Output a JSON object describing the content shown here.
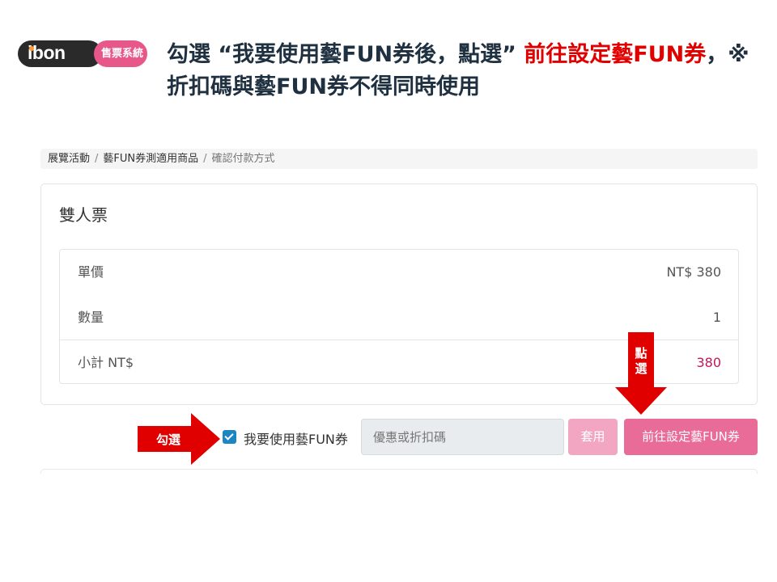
{
  "logo": {
    "brand": "ibon",
    "system": "售票系統"
  },
  "headline": {
    "part1": "勾選 “我要使用藝FUN券後，點選” ",
    "part2_red": "前往設定藝FUN券",
    "part3": "，※折扣碼與藝FUN券不得同時使用"
  },
  "breadcrumb": {
    "items": [
      "展覽活動",
      "藝FUN券測適用商品"
    ],
    "separator": "/",
    "current": "確認付款方式"
  },
  "ticket": {
    "title": "雙人票",
    "unit_price_label": "單價",
    "unit_price_value": "NT$  380",
    "quantity_label": "數量",
    "quantity_value": "1",
    "subtotal_label": "小計  NT$",
    "subtotal_value": "380"
  },
  "actions": {
    "checkbox_label": "我要使用藝FUN券",
    "checkbox_checked": true,
    "coupon_placeholder": "優惠或折扣碼",
    "apply_label": "套用",
    "goto_label": "前往設定藝FUN券"
  },
  "annotations": {
    "check_arrow_text": "勾選",
    "click_arrow_text": "點選"
  },
  "colors": {
    "accent_pink": "#e96b97",
    "annotation_red": "#e00000",
    "checkbox_blue": "#1c86c2"
  }
}
